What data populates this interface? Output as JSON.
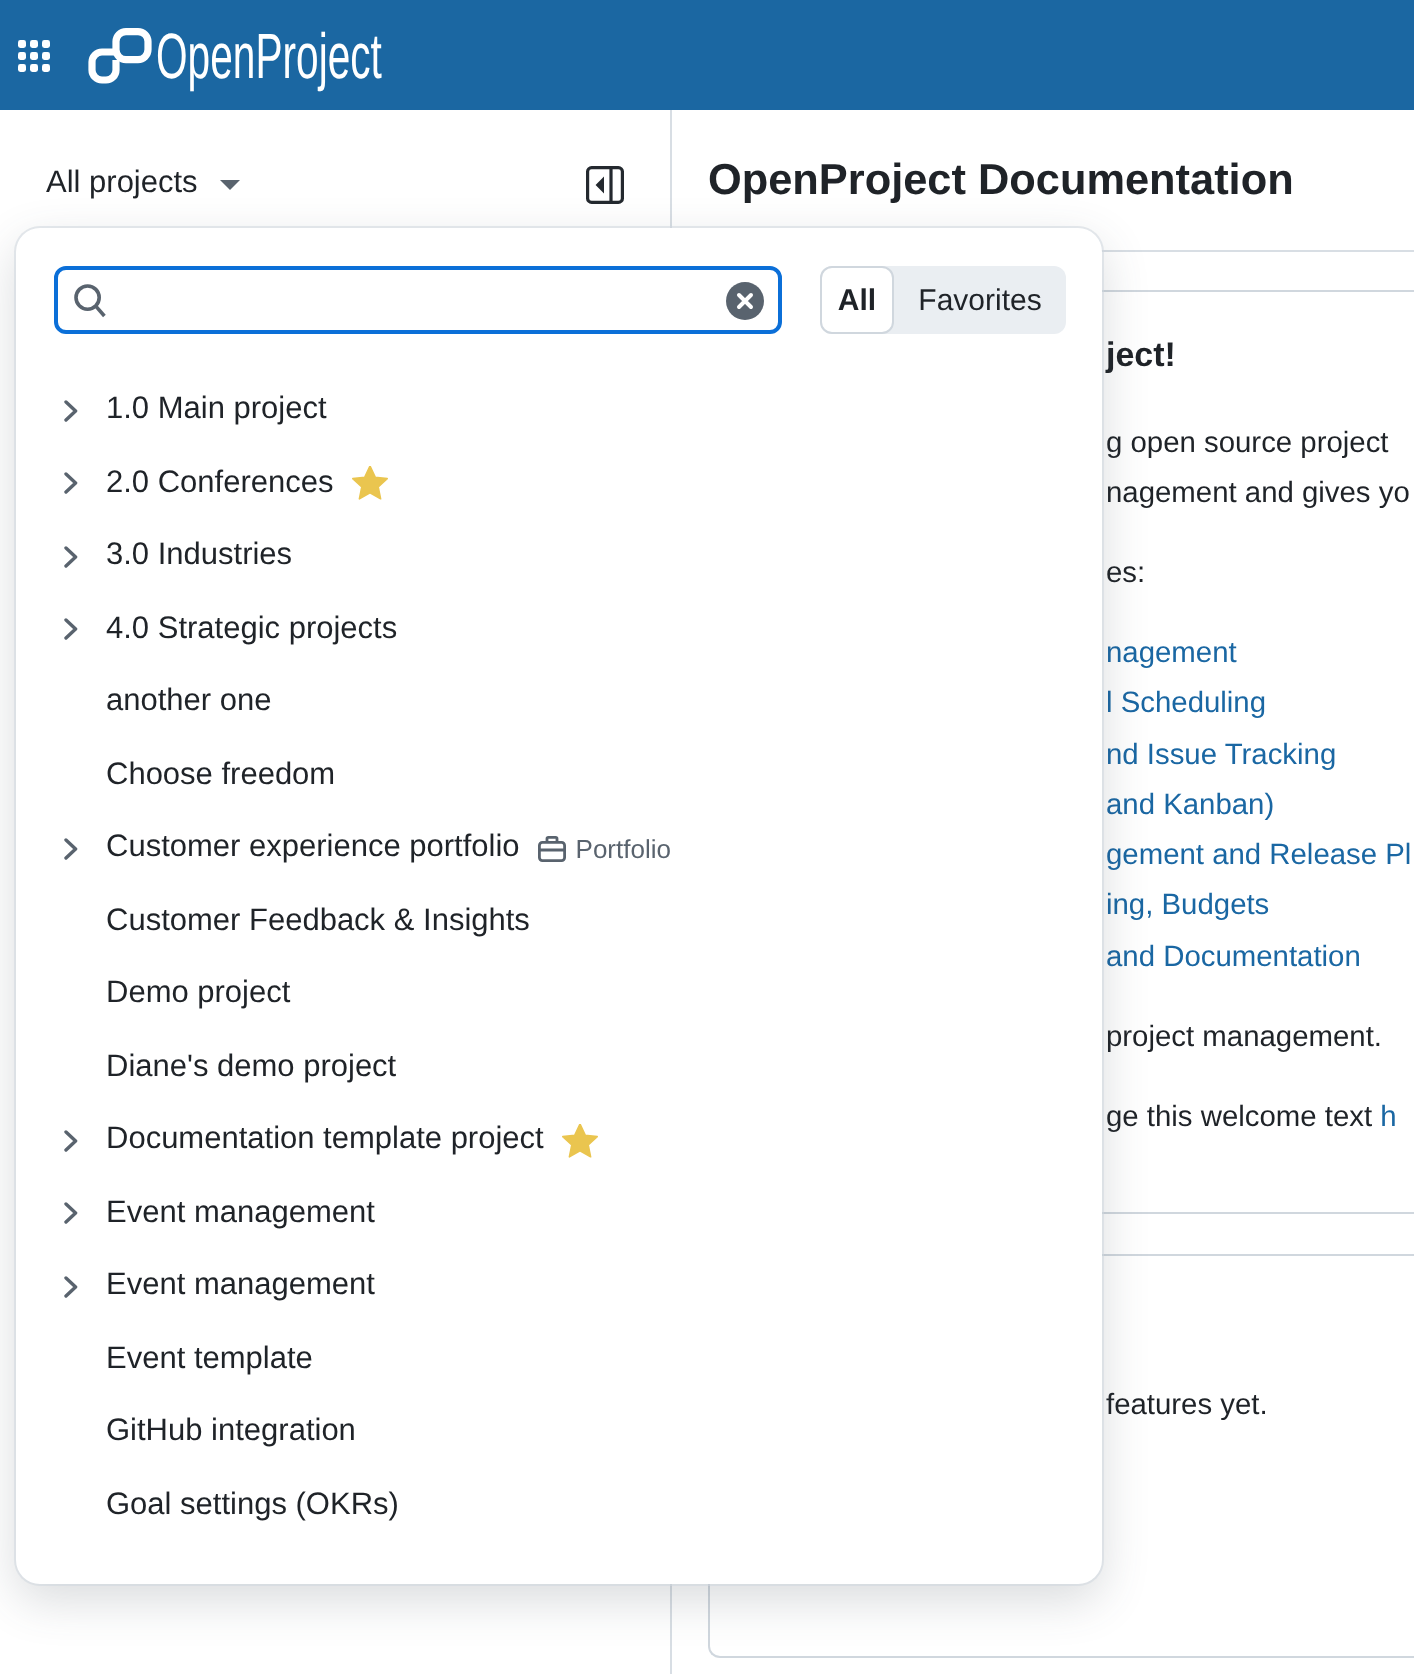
{
  "header": {
    "app_name": "OpenProject"
  },
  "sidebar": {
    "project_selector": {
      "label": "All projects"
    }
  },
  "page": {
    "title": "OpenProject Documentation"
  },
  "widgets": [
    {
      "blocks": [
        {
          "kind": "heading",
          "text": "ject!"
        },
        {
          "kind": "paragraph",
          "lines": [
            "g open source project",
            "nagement and gives yo"
          ]
        },
        {
          "kind": "paragraph",
          "lines": [
            "es:"
          ]
        },
        {
          "kind": "links",
          "items": [
            "nagement",
            "l Scheduling",
            "nd Issue Tracking",
            "and Kanban)",
            "gement and Release Pl",
            "ing, Budgets",
            "and Documentation"
          ]
        },
        {
          "kind": "paragraph",
          "lines": [
            "project management."
          ]
        },
        {
          "kind": "paragraph",
          "lines": [
            "ge this welcome text"
          ],
          "link": "h"
        }
      ]
    },
    {
      "blocks": [
        {
          "kind": "paragraph",
          "lines": [
            "features yet."
          ]
        }
      ]
    }
  ],
  "project_menu": {
    "search": {
      "focused": true
    },
    "filter": [
      {
        "label": "All",
        "selected": true
      },
      {
        "label": "Favorites",
        "selected": false
      }
    ],
    "projects": [
      {
        "name": "1.0 Main project",
        "has_children": true,
        "favorite": false
      },
      {
        "name": "2.0 Conferences",
        "has_children": true,
        "favorite": true
      },
      {
        "name": "3.0 Industries",
        "has_children": true,
        "favorite": false
      },
      {
        "name": "4.0 Strategic projects",
        "has_children": true,
        "favorite": false
      },
      {
        "name": "another one",
        "has_children": false,
        "favorite": false
      },
      {
        "name": "Choose freedom",
        "has_children": false,
        "favorite": false
      },
      {
        "name": "Customer experience portfolio",
        "has_children": true,
        "favorite": false,
        "badge": "Portfolio"
      },
      {
        "name": "Customer Feedback & Insights",
        "has_children": false,
        "favorite": false
      },
      {
        "name": "Demo project",
        "has_children": false,
        "favorite": false
      },
      {
        "name": "Diane's demo project",
        "has_children": false,
        "favorite": false
      },
      {
        "name": "Documentation template project",
        "has_children": true,
        "favorite": true
      },
      {
        "name": "Event management",
        "has_children": true,
        "favorite": false
      },
      {
        "name": "Event management",
        "has_children": true,
        "favorite": false
      },
      {
        "name": "Event template",
        "has_children": false,
        "favorite": false
      },
      {
        "name": "GitHub integration",
        "has_children": false,
        "favorite": false
      },
      {
        "name": "Goal settings (OKRs)",
        "has_children": false,
        "favorite": false
      }
    ]
  }
}
